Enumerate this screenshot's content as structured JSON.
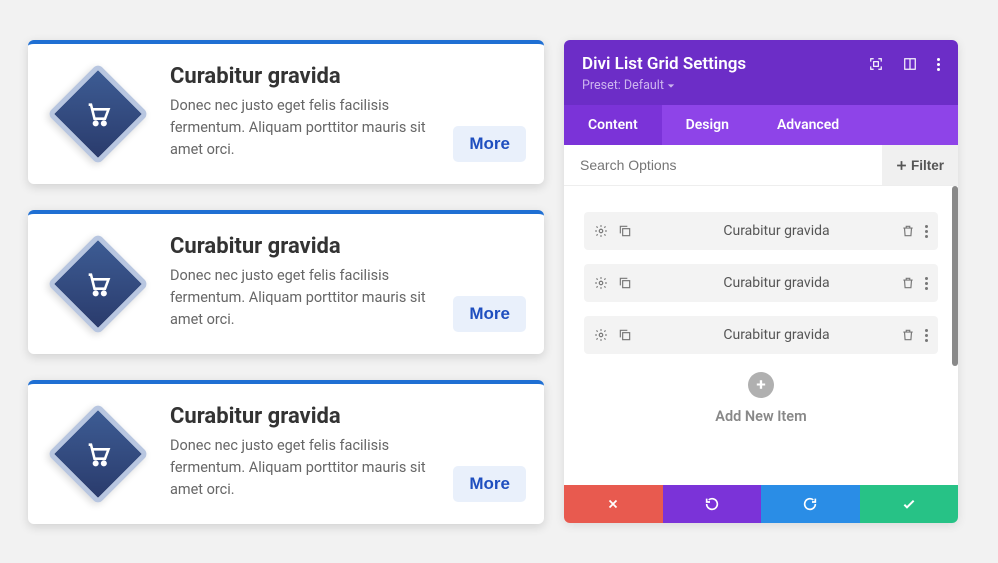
{
  "preview": {
    "cards": [
      {
        "title": "Curabitur gravida",
        "desc": "Donec nec justo eget felis facilisis fermentum. Aliquam porttitor mauris sit amet orci.",
        "more": "More"
      },
      {
        "title": "Curabitur gravida",
        "desc": "Donec nec justo eget felis facilisis fermentum. Aliquam porttitor mauris sit amet orci.",
        "more": "More"
      },
      {
        "title": "Curabitur gravida",
        "desc": "Donec nec justo eget felis facilisis fermentum. Aliquam porttitor mauris sit amet orci.",
        "more": "More"
      }
    ],
    "icon": "cart-icon"
  },
  "panel": {
    "title": "Divi List Grid Settings",
    "preset_label": "Preset: Default",
    "tabs": [
      {
        "label": "Content",
        "active": true
      },
      {
        "label": "Design",
        "active": false
      },
      {
        "label": "Advanced",
        "active": false
      }
    ],
    "search_placeholder": "Search Options",
    "filter_label": "Filter",
    "items": [
      {
        "label": "Curabitur gravida"
      },
      {
        "label": "Curabitur gravida"
      },
      {
        "label": "Curabitur gravida"
      }
    ],
    "add_label": "Add New Item"
  },
  "colors": {
    "accent_blue": "#1f6fd3",
    "purple_dark": "#6c2dc7",
    "purple_light": "#8e44e8"
  }
}
